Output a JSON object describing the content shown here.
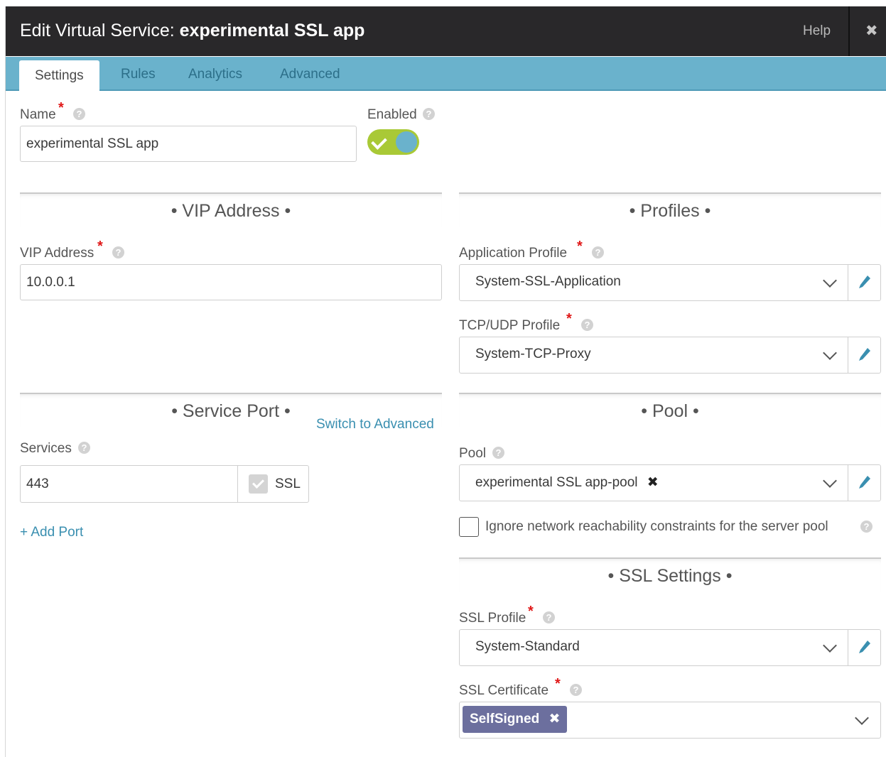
{
  "window": {
    "title_prefix": "Edit Virtual Service:",
    "title_name": "experimental SSL app",
    "help": "Help",
    "close": "✖"
  },
  "tabs": [
    {
      "label": "Settings",
      "active": true
    },
    {
      "label": "Rules",
      "active": false
    },
    {
      "label": "Analytics",
      "active": false
    },
    {
      "label": "Advanced",
      "active": false
    }
  ],
  "name_field": {
    "label": "Name",
    "value": "experimental SSL app"
  },
  "enabled": {
    "label": "Enabled",
    "state": true
  },
  "vip_section": {
    "title": "• VIP Address •",
    "field_label": "VIP Address",
    "value": "10.0.0.1"
  },
  "profiles_section": {
    "title": "• Profiles •",
    "app_profile": {
      "label": "Application Profile",
      "value": "System-SSL-Application"
    },
    "tcp_profile": {
      "label": "TCP/UDP Profile",
      "value": "System-TCP-Proxy"
    }
  },
  "service_port_section": {
    "title": "• Service Port •",
    "switch_link": "Switch to Advanced",
    "services_label": "Services",
    "port": "443",
    "ssl_label": "SSL",
    "ssl_checked": true,
    "add_port": "+ Add Port"
  },
  "pool_section": {
    "title": "• Pool •",
    "pool_label": "Pool",
    "pool_value": "experimental SSL app-pool",
    "ignore_label": "Ignore network reachability constraints for the server pool",
    "ignore_checked": false
  },
  "ssl_section": {
    "title": "• SSL Settings •",
    "ssl_profile": {
      "label": "SSL Profile",
      "value": "System-Standard"
    },
    "ssl_cert": {
      "label": "SSL Certificate",
      "chip": "SelfSigned"
    }
  },
  "colors": {
    "titlebar": "#29282a",
    "tabbar": "#6ab2cc",
    "toggle_on": "#a9c936",
    "link": "#3a8fb0",
    "chip": "#6c6f9e",
    "required": "#e01818"
  }
}
